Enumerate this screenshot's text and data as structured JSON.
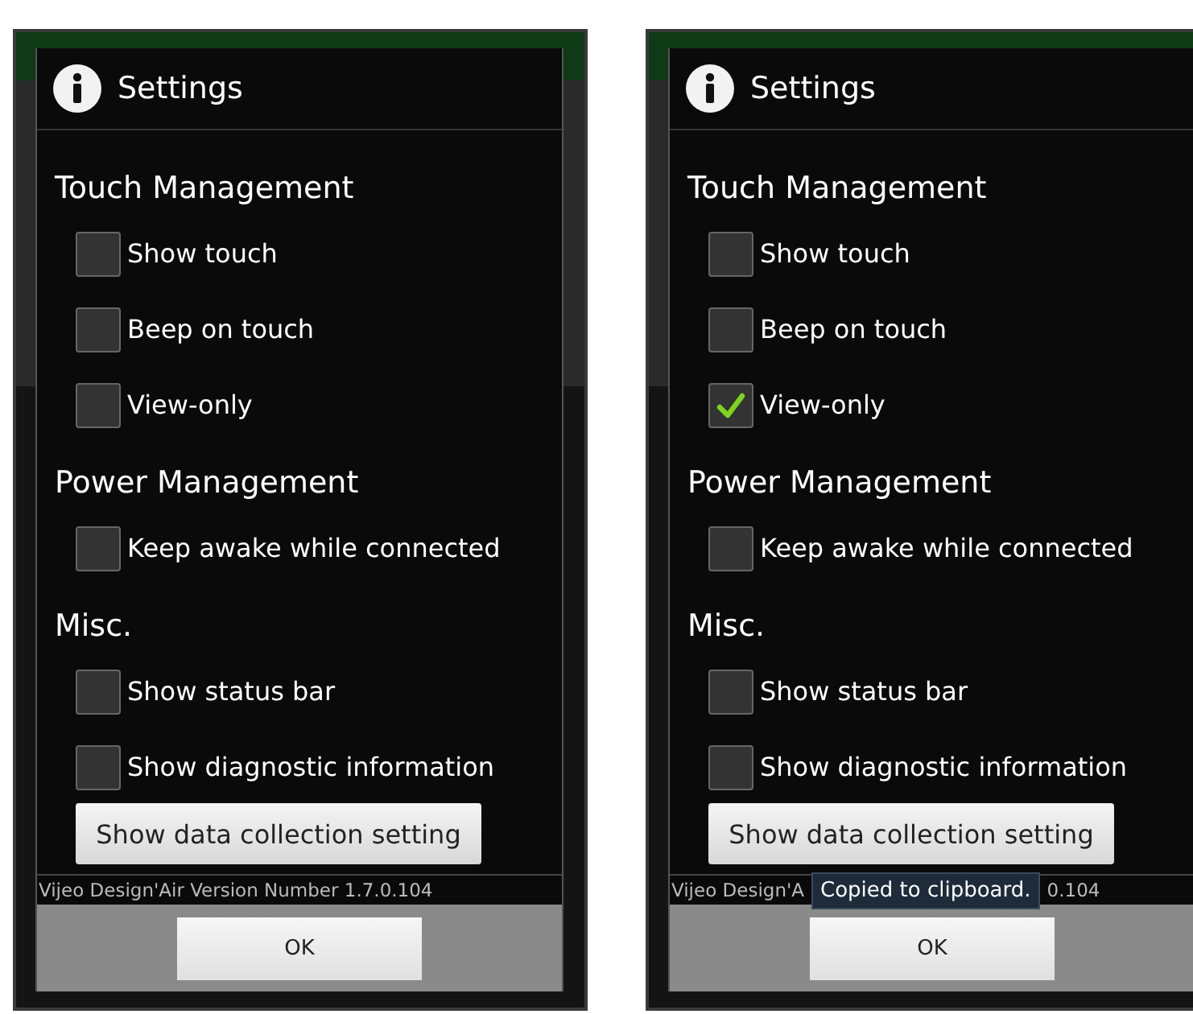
{
  "screens": [
    {
      "dialog": {
        "title": "Settings",
        "sections": [
          {
            "heading": "Touch Management",
            "options": [
              {
                "label": "Show touch",
                "checked": false
              },
              {
                "label": "Beep on touch",
                "checked": false
              },
              {
                "label": "View-only",
                "checked": false
              }
            ]
          },
          {
            "heading": "Power Management",
            "options": [
              {
                "label": "Keep awake while connected",
                "checked": false
              }
            ]
          },
          {
            "heading": "Misc.",
            "options": [
              {
                "label": "Show status bar",
                "checked": false
              },
              {
                "label": "Show diagnostic information",
                "checked": false
              }
            ]
          }
        ],
        "action_button": "Show data collection setting",
        "version": [
          "Vijeo Design'Air Version Number 1.7.0.104"
        ],
        "ok_button": "OK"
      }
    },
    {
      "dialog": {
        "title": "Settings",
        "sections": [
          {
            "heading": "Touch Management",
            "options": [
              {
                "label": "Show touch",
                "checked": false
              },
              {
                "label": "Beep on touch",
                "checked": false
              },
              {
                "label": "View-only",
                "checked": true
              }
            ]
          },
          {
            "heading": "Power Management",
            "options": [
              {
                "label": "Keep awake while connected",
                "checked": false
              }
            ]
          },
          {
            "heading": "Misc.",
            "options": [
              {
                "label": "Show status bar",
                "checked": false
              },
              {
                "label": "Show diagnostic information",
                "checked": false
              }
            ]
          }
        ],
        "action_button": "Show data collection setting",
        "version": [
          "Vijeo Design'A",
          "0.104"
        ],
        "toast": "Copied to clipboard.",
        "ok_button": "OK"
      }
    }
  ]
}
